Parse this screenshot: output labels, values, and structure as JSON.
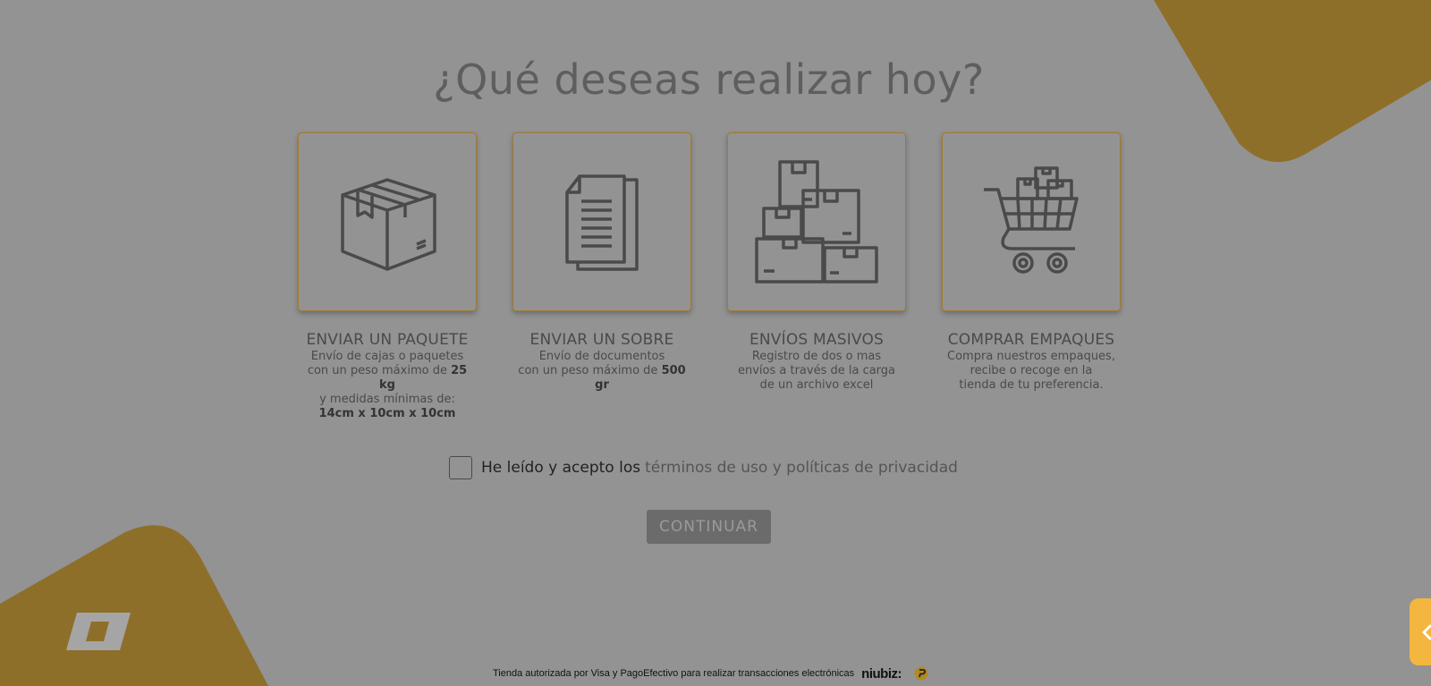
{
  "colors": {
    "background": "#939393",
    "accent_gold": "#8e6f2a",
    "card_border": "#a07a2e",
    "side_tab": "#f3b63e",
    "button_bg": "#6b6b6b"
  },
  "header": {
    "title": "¿Qué deseas realizar hoy?"
  },
  "cards": [
    {
      "icon": "package-box-icon",
      "title": "ENVIAR UN PAQUETE",
      "desc_line1": "Envío de cajas o paquetes",
      "desc_line2a": "con un peso máximo de ",
      "desc_line2b": "25 kg",
      "desc_line3": "y medidas mínimas de:",
      "desc_line4": "14cm x 10cm x 10cm"
    },
    {
      "icon": "document-envelope-icon",
      "title": "ENVIAR UN SOBRE",
      "desc_line1": "Envío de documentos",
      "desc_line2a": "con un peso máximo de ",
      "desc_line2b": "500",
      "desc_line3": "gr"
    },
    {
      "icon": "stacked-boxes-icon",
      "title": "ENVÍOS MASIVOS",
      "desc_line1": "Registro de dos o mas",
      "desc_line2": "envíos a través de la carga",
      "desc_line3": "de un archivo excel"
    },
    {
      "icon": "shopping-cart-icon",
      "title": "COMPRAR EMPAQUES",
      "desc_line1": "Compra nuestros empaques,",
      "desc_line2": "recibe o recoge en la",
      "desc_line3": "tienda de tu preferencia."
    }
  ],
  "terms": {
    "checked": false,
    "label": "He leído y acepto los",
    "link": "términos de uso y políticas de privacidad"
  },
  "actions": {
    "continue_label": "CONTINUAR"
  },
  "side_tab": {
    "icon": "chevron-left-icon"
  },
  "footer": {
    "text": "Tienda autorizada por Visa y PagoEfectivo para realizar transacciones electrónicas",
    "niubiz": "niubiz"
  }
}
